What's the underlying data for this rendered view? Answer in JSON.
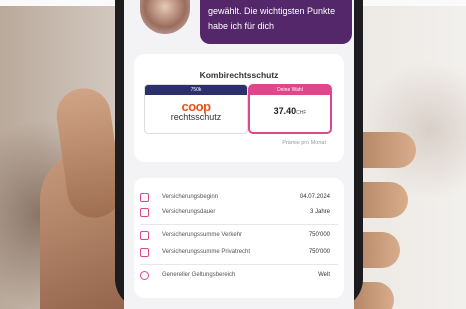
{
  "chat": {
    "message": "gewählt. Die wichtigsten Punkte habe ich für dich"
  },
  "offer": {
    "title": "Kombirechtsschutz",
    "left_header": "750k",
    "left_logo_top": "coop",
    "left_logo_bottom": "rechtsschutz",
    "right_header": "Deine Wahl",
    "price": "37.40",
    "currency": "CHF",
    "note": "Prämie pro Monat"
  },
  "details": [
    {
      "icon": "flag-icon",
      "label": "Versicherungsbeginn",
      "value": "04.07.2024"
    },
    {
      "icon": "calendar-icon",
      "label": "Versicherungsdauer",
      "value": "3 Jahre"
    },
    {
      "icon": "traffic-icon",
      "label": "Versicherungssumme Verkehr",
      "value": "750'000"
    },
    {
      "icon": "document-icon",
      "label": "Versicherungssumme Privatrecht",
      "value": "750'000"
    },
    {
      "icon": "globe-icon",
      "label": "Genereller Geltungsbereich",
      "value": "Welt"
    }
  ],
  "colors": {
    "accent": "#e2468a",
    "bubble": "#54276a",
    "brand": "#e8541b"
  }
}
